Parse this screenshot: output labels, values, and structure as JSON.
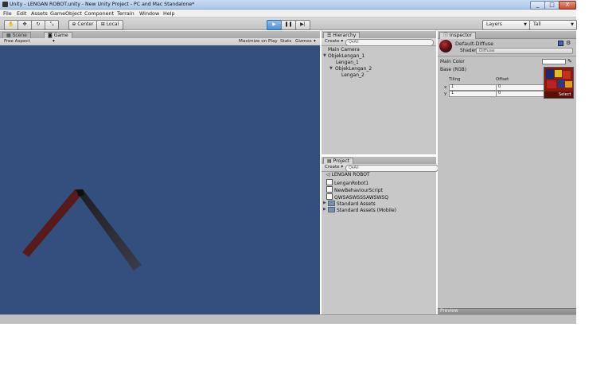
{
  "window": {
    "title": "Unity - LENGAN ROBOT.unity - New Unity Project - PC and Mac Standalone*",
    "minimize": "_",
    "maximize": "□",
    "close": "X"
  },
  "menu": [
    "File",
    "Edit",
    "Assets",
    "GameObject",
    "Component",
    "Terrain",
    "Window",
    "Help"
  ],
  "toolbar": {
    "pivot_label": "Center",
    "space_label": "Local",
    "layers_label": "Layers",
    "layout_label": "Tall"
  },
  "scene_panel": {
    "tabs": [
      "Scene",
      "Game"
    ],
    "aspect": "Free Aspect",
    "maximize_on_play": "Maximize on Play",
    "stats": "Stats",
    "gizmos": "Gizmos"
  },
  "hierarchy": {
    "tab": "Hierarchy",
    "create": "Create ▾",
    "search_placeholder": "Q▾All",
    "items": [
      "Main Camera",
      "ObjekLengan_1",
      "Lengan_1",
      "ObjekLengan_2",
      "Lengan_2"
    ]
  },
  "project": {
    "tab": "Project",
    "create": "Create ▾",
    "search_placeholder": "Q▾All",
    "items": [
      "LENGAN ROBOT",
      "LenganRobot1",
      "NewBehaviourScript",
      "QWSASWSSSAWSWSQ",
      "Standard Assets",
      "Standard Assets (Mobile)"
    ]
  },
  "inspector": {
    "tab": "Inspector",
    "material_name": "Default-Diffuse",
    "shader_label": "Shader",
    "shader_value": "Diffuse",
    "main_color_label": "Main Color",
    "base_label": "Base (RGB)",
    "tiling_label": "Tiling",
    "offset_label": "Offset",
    "x_label": "x",
    "y_label": "y",
    "tiling_x": "1",
    "tiling_y": "1",
    "offset_x": "0",
    "offset_y": "0",
    "select_label": "Select",
    "preview_label": "Preview"
  },
  "colors": {
    "scene_bg": "#324f7e",
    "play_active": "#4b8fd6",
    "panel_bg": "#c2c2c2"
  }
}
